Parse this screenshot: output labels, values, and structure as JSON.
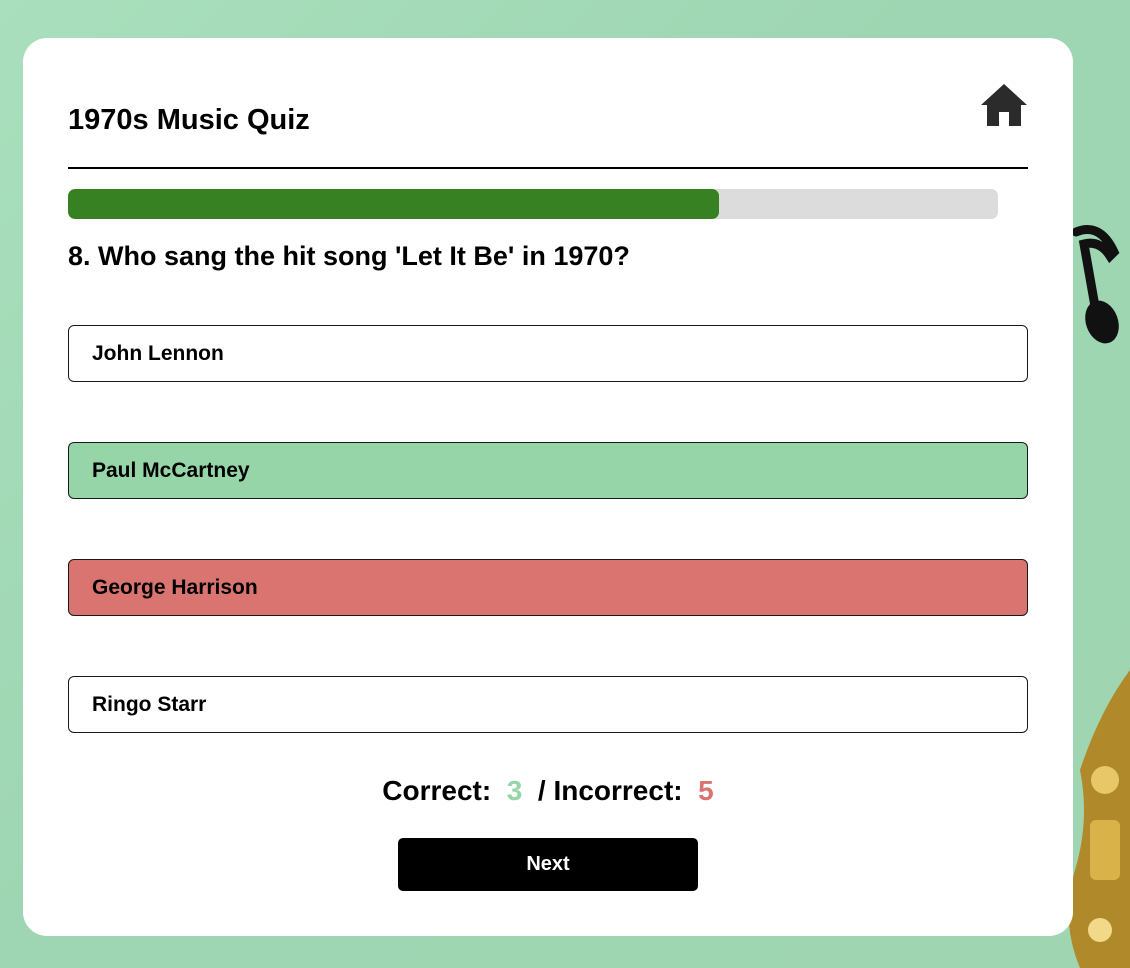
{
  "quiz": {
    "title": "1970s Music Quiz",
    "progress_fraction": 0.7,
    "question": "8. Who sang the hit song 'Let It Be' in 1970?",
    "answers": [
      {
        "label": "John Lennon",
        "state": "neutral"
      },
      {
        "label": "Paul McCartney",
        "state": "correct"
      },
      {
        "label": "George Harrison",
        "state": "incorrect"
      },
      {
        "label": "Ringo Starr",
        "state": "neutral"
      }
    ],
    "score": {
      "correct_label": "Correct:",
      "correct_value": "3",
      "separator": "/ Incorrect:",
      "incorrect_value": "5"
    },
    "next_label": "Next"
  },
  "icons": {
    "home": "home-icon"
  },
  "colors": {
    "background": "#a9dfbc",
    "progress_fill": "#378122",
    "progress_track": "#dcdcdc",
    "correct": "#96d5a7",
    "incorrect": "#da7470",
    "button": "#000000"
  }
}
